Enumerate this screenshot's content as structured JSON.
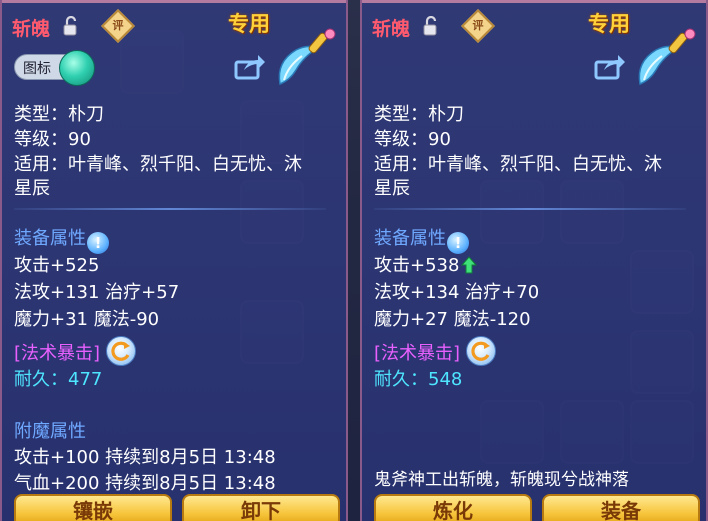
{
  "colors": {
    "name_red": "#ff5a6e",
    "exclusive_gold": "#ffd23a",
    "section_blue": "#6fa8ff",
    "magic_purple": "#e860ff",
    "durability_cyan": "#4ee6ff",
    "button_gold": "#f6c43a"
  },
  "left": {
    "name": "斩魄",
    "review_badge": "评",
    "exclusive": "专用",
    "toggle_label": "图标",
    "type": "类型：朴刀",
    "level": "等级：90",
    "applicable_1": "适用：叶青峰、烈千阳、白无忧、沐",
    "applicable_2": "星辰",
    "equip_attr": "装备属性",
    "attack": "攻击+525",
    "line_mag_heal": "法攻+131 治疗+57",
    "line_power_magic": "魔力+31 魔法-90",
    "crit": "[法术暴击]",
    "durability_label": "耐久：",
    "durability_value": "477",
    "enchant_title": "附魔属性",
    "enchant_1": "攻击+100 持续到8月5日 13:48",
    "enchant_2": "气血+200 持续到8月5日 13:48",
    "btn_inlay": "镶嵌",
    "btn_unequip": "卸下"
  },
  "right": {
    "name": "斩魄",
    "review_badge": "评",
    "exclusive": "专用",
    "type": "类型：朴刀",
    "level": "等级：90",
    "applicable_1": "适用：叶青峰、烈千阳、白无忧、沐",
    "applicable_2": "星辰",
    "equip_attr": "装备属性",
    "attack": "攻击+538",
    "line_mag_heal": "法攻+134 治疗+70",
    "line_power_magic": "魔力+27 魔法-120",
    "crit": "[法术暴击]",
    "durability_label": "耐久：",
    "durability_value": "548",
    "flavor": "鬼斧神工出斩魄，斩魄现兮战神落",
    "btn_refine": "炼化",
    "btn_spare": "装备"
  },
  "icons": [
    "lock-open-icon",
    "review-badge-icon",
    "share-icon",
    "weapon-blade-icon",
    "info-icon",
    "up-arrow-icon",
    "refresh-icon"
  ]
}
